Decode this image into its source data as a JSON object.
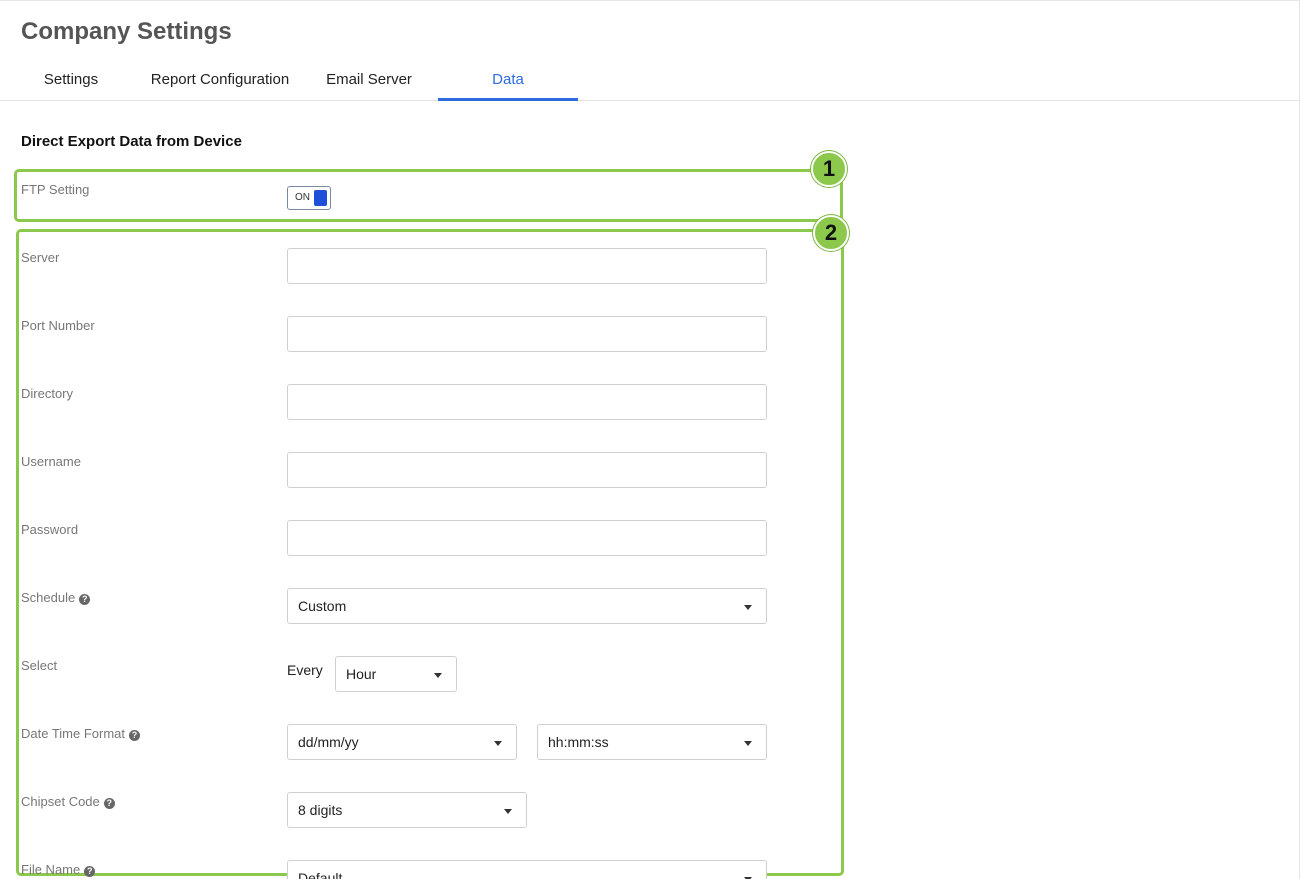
{
  "header": {
    "title": "Company Settings"
  },
  "tabs": [
    {
      "label": "Settings"
    },
    {
      "label": "Report Configuration"
    },
    {
      "label": "Email Server"
    },
    {
      "label": "Data"
    }
  ],
  "active_tab": "Data",
  "accent_color": "#2d6cdf",
  "annotation_color": "#8cc84b",
  "section": {
    "title": "Direct Export Data from Device"
  },
  "annotations": {
    "badge1": "1",
    "badge2": "2"
  },
  "ftp": {
    "label": "FTP Setting",
    "toggle_label": "ON"
  },
  "fields": {
    "server": {
      "label": "Server",
      "value": ""
    },
    "port": {
      "label": "Port Number",
      "value": ""
    },
    "directory": {
      "label": "Directory",
      "value": ""
    },
    "username": {
      "label": "Username",
      "value": ""
    },
    "password": {
      "label": "Password",
      "value": ""
    }
  },
  "schedule": {
    "label": "Schedule",
    "value": "Custom"
  },
  "select_row": {
    "label": "Select",
    "every": "Every",
    "value": "Hour"
  },
  "datetime": {
    "label": "Date Time Format",
    "date_value": "dd/mm/yy",
    "time_value": "hh:mm:ss"
  },
  "chipset": {
    "label": "Chipset Code",
    "value": "8 digits"
  },
  "filename": {
    "label": "File Name",
    "value": "Default"
  },
  "icons": {
    "help": "question-circle-icon",
    "caret": "caret-down-icon"
  }
}
